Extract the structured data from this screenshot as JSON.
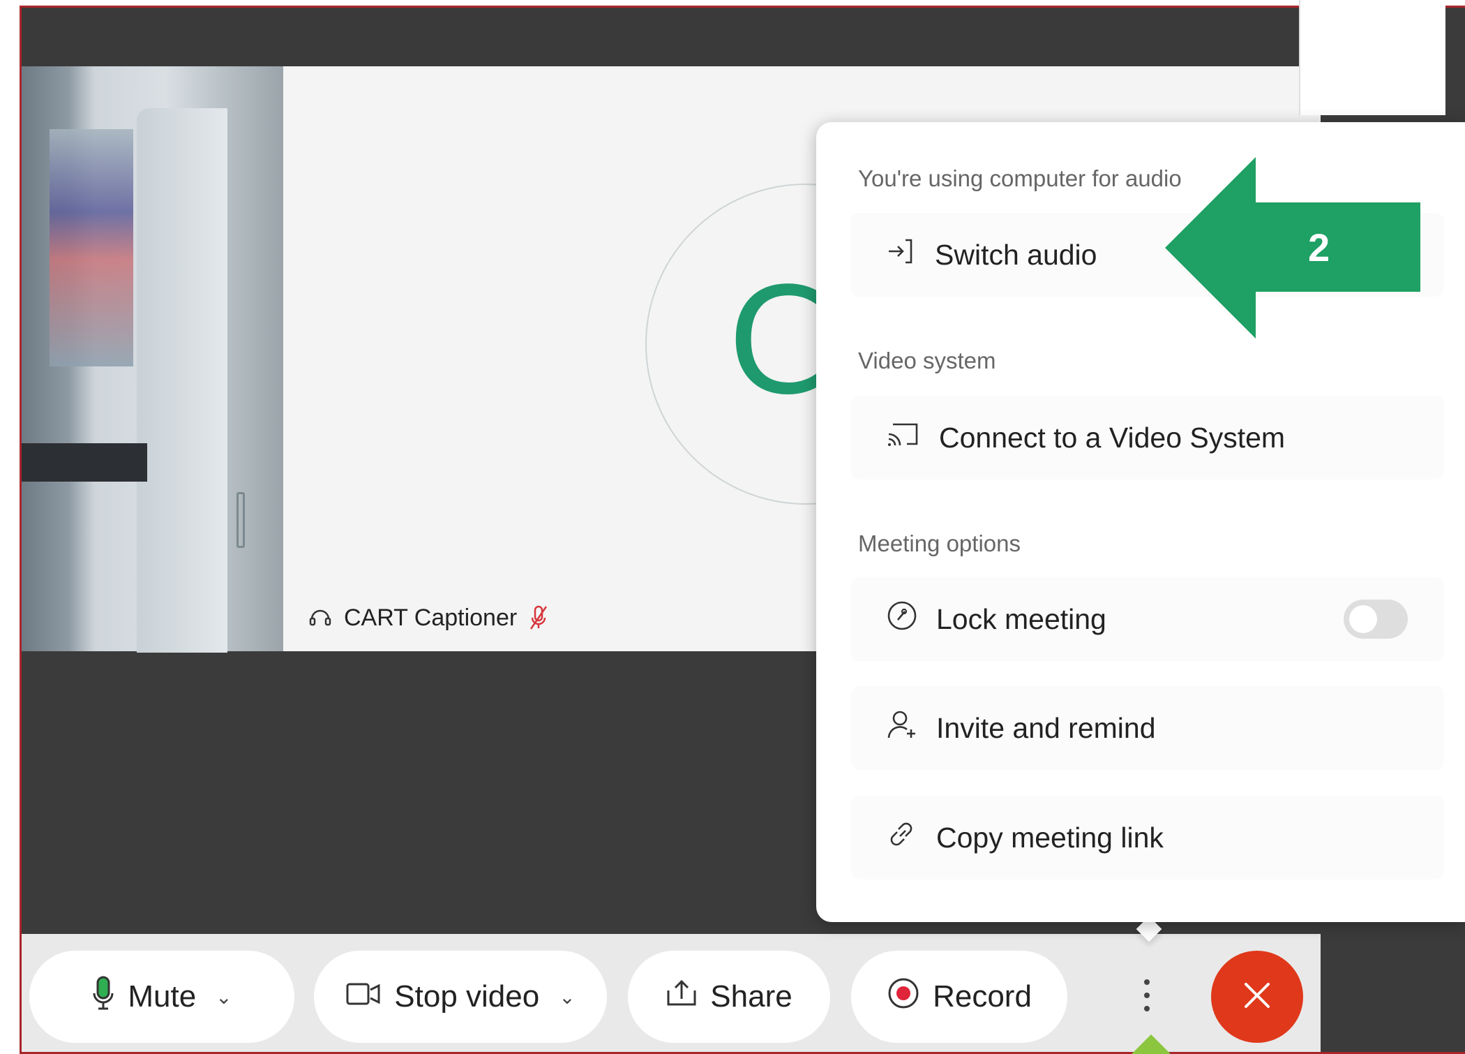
{
  "participant": {
    "initials": "CC",
    "name": "CART Captioner"
  },
  "menu": {
    "audio_section_label": "You're using computer for audio",
    "switch_audio_label": "Switch audio",
    "video_section_label": "Video system",
    "connect_video_label": "Connect to a Video System",
    "meeting_section_label": "Meeting options",
    "lock_meeting_label": "Lock meeting",
    "lock_meeting_on": false,
    "invite_label": "Invite and remind",
    "copy_link_label": "Copy meeting link"
  },
  "controls": {
    "mute_label": "Mute",
    "stop_video_label": "Stop video",
    "share_label": "Share",
    "record_label": "Record",
    "more_icon": "more-vertical-icon",
    "end_icon": "close-icon"
  },
  "annotation": {
    "step_number": "2",
    "color": "#1fa064"
  },
  "colors": {
    "end_call": "#e0381a",
    "avatar_accent": "#1f9a6e",
    "frame_border": "#a7262c"
  }
}
